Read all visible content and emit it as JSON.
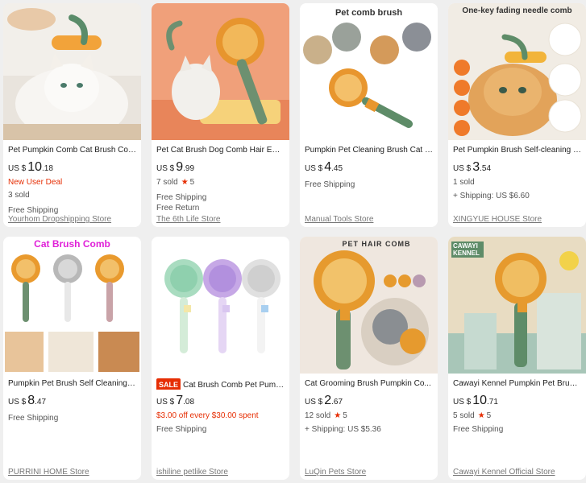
{
  "products": [
    {
      "title": "Pet Pumpkin Comb Cat Brush Com...",
      "price_currency": "US $",
      "price_main": "10",
      "price_frac": ".18",
      "deal": "New User Deal",
      "sold": "3 sold",
      "rating": "",
      "shipping": "Free Shipping",
      "extra": "",
      "store": "Yourhom Dropshipping Store",
      "thumb_text": ""
    },
    {
      "title": "Pet Cat Brush Dog Comb Hair Emo...",
      "price_currency": "US $",
      "price_main": "9",
      "price_frac": ".99",
      "sold": "7 sold",
      "rating": "5",
      "shipping": "Free Shipping",
      "extra": "Free Return",
      "store": "The 6th Life Store",
      "thumb_text": ""
    },
    {
      "title": "Pumpkin Pet Cleaning Brush Cat M...",
      "price_currency": "US $",
      "price_main": "4",
      "price_frac": ".45",
      "shipping": "Free Shipping",
      "store": "Manual Tools Store",
      "thumb_text": "Pet comb brush"
    },
    {
      "title": "Pet Pumpkin Brush Self-cleaning s...",
      "price_currency": "US $",
      "price_main": "3",
      "price_frac": ".54",
      "sold": "1 sold",
      "shipping": "+ Shipping: US $6.60",
      "store": "XINGYUE HOUSE Store",
      "thumb_text": "One-key fading needle comb"
    },
    {
      "title": "Pumpkin Pet Brush Self Cleaning S...",
      "price_currency": "US $",
      "price_main": "8",
      "price_frac": ".47",
      "shipping": "Free Shipping",
      "store": "PURRINI HOME Store",
      "thumb_text": "Cat Brush Comb"
    },
    {
      "title": "Cat Brush Comb Pet Pump...",
      "sale_badge": "SALE",
      "price_currency": "US $",
      "price_main": "7",
      "price_frac": ".08",
      "deal": "$3.00 off every $30.00 spent",
      "shipping": "Free Shipping",
      "store": "ishiline petlike Store"
    },
    {
      "title": "Cat Grooming Brush Pumpkin Co...",
      "price_currency": "US $",
      "price_main": "2",
      "price_frac": ".67",
      "sold": "12 sold",
      "rating": "5",
      "shipping": "+ Shipping: US $5.36",
      "store": "LuQin Pets Store",
      "thumb_text": "PET HAIR COMB"
    },
    {
      "title": "Cawayi Kennel Pumpkin Pet Brush...",
      "price_currency": "US $",
      "price_main": "10",
      "price_frac": ".71",
      "sold": "5 sold",
      "rating": "5",
      "shipping": "Free Shipping",
      "store": "Cawayi Kennel Official Store",
      "thumb_text": "CAWAYI KENNEL"
    }
  ],
  "icons": {
    "star": "★"
  },
  "colors": {
    "accent": "#e62e04",
    "text": "#191919",
    "muted": "#777777"
  }
}
